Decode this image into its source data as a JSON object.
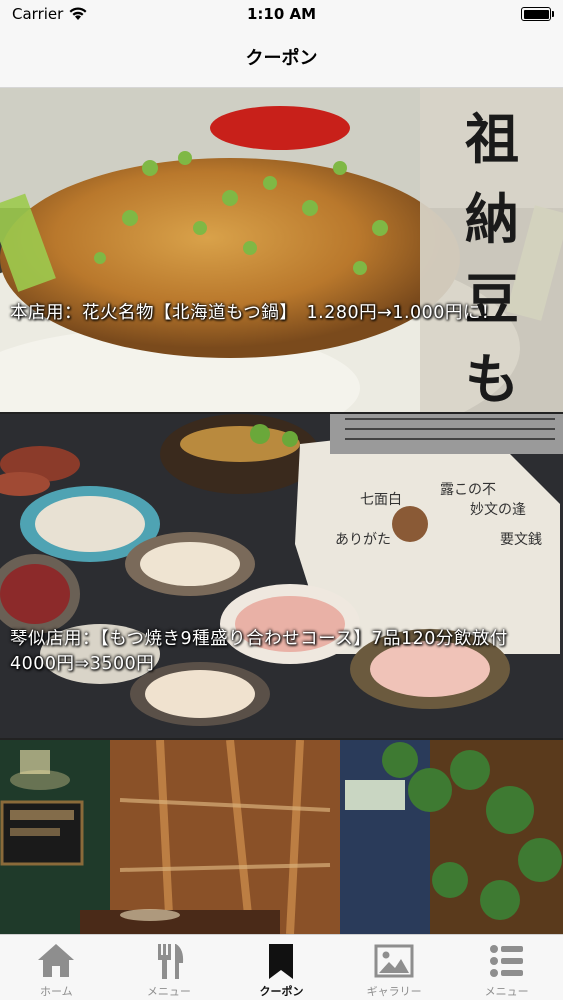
{
  "status_bar": {
    "carrier": "Carrier",
    "time": "1:10 AM"
  },
  "nav": {
    "title": "クーポン"
  },
  "coupons": [
    {
      "text": "本店用：花火名物【北海道もつ鍋】　1.280円→1.000円に！",
      "image": "motsu-nabe-photo",
      "sign_text": "祖納豆も"
    },
    {
      "text": "琴似店用：【もつ焼き9種盛り合わせコース】7品120分飲放付4000円⇒3500円",
      "image": "motsu-yaki-platter-photo"
    },
    {
      "text": "",
      "image": "restaurant-interior-photo"
    }
  ],
  "tabs": [
    {
      "label": "ホーム",
      "icon": "home-icon",
      "active": false
    },
    {
      "label": "メニュー",
      "icon": "fork-knife-icon",
      "active": false
    },
    {
      "label": "クーポン",
      "icon": "bookmark-icon",
      "active": true
    },
    {
      "label": "ギャラリー",
      "icon": "picture-icon",
      "active": false
    },
    {
      "label": "メニュー",
      "icon": "list-icon",
      "active": false
    }
  ],
  "colors": {
    "tab_active": "#111111",
    "tab_inactive": "#8e8e8e",
    "bar_background": "#f7f7f7"
  }
}
